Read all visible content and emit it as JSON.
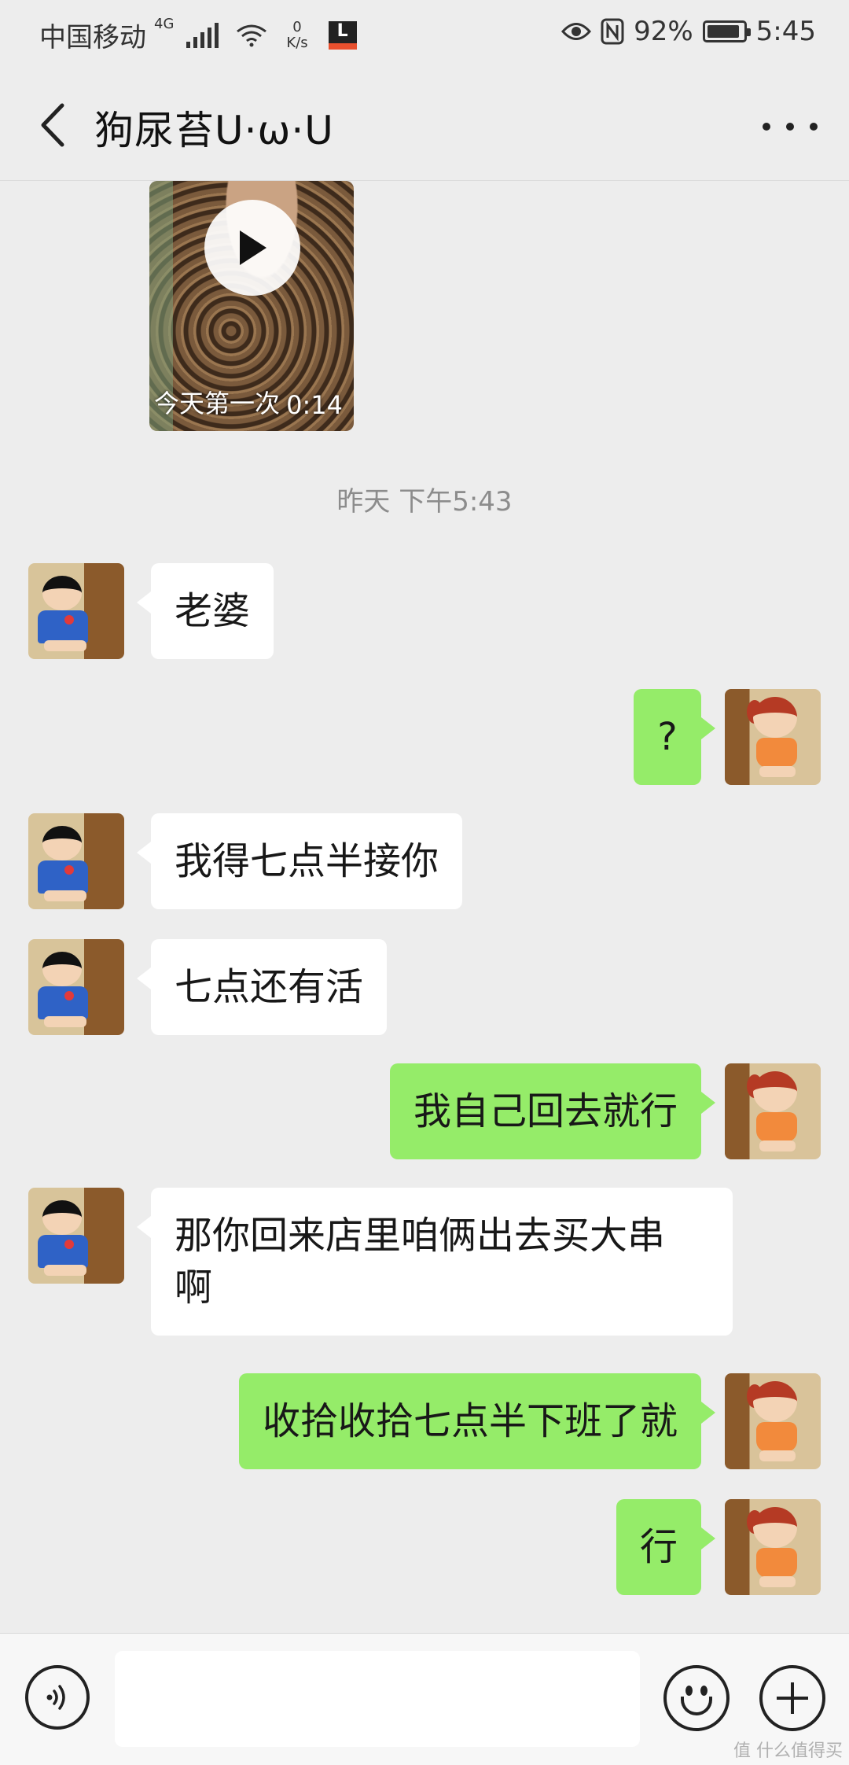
{
  "status_bar": {
    "carrier": "中国移动",
    "network": "4G",
    "net_speed_value": "0",
    "net_speed_unit": "K/s",
    "app_icon_letter": "L",
    "battery": "92%",
    "battery_level": 0.92,
    "time": "5:45"
  },
  "header": {
    "title": "狗尿苔U·ω·U"
  },
  "video_message": {
    "caption": "今天第一次",
    "duration": "0:14"
  },
  "timestamp": "昨天 下午5:43",
  "messages": [
    {
      "side": "in",
      "text": "老婆"
    },
    {
      "side": "out",
      "text": "?"
    },
    {
      "side": "in",
      "text": "我得七点半接你"
    },
    {
      "side": "in",
      "text": "七点还有活"
    },
    {
      "side": "out",
      "text": "我自己回去就行"
    },
    {
      "side": "in",
      "text": "那你回来店里咱俩出去买大串\n啊"
    },
    {
      "side": "out",
      "text": "收拾收拾七点半下班了就"
    },
    {
      "side": "out",
      "text": "行"
    }
  ],
  "input": {
    "value": "",
    "placeholder": ""
  },
  "icons": {
    "back": "chevron-left-icon",
    "more": "more-dots-icon",
    "play": "play-icon",
    "voice": "voice-icon",
    "emoji": "emoji-icon",
    "add": "plus-icon"
  },
  "colors": {
    "background": "#ededed",
    "bubble_out": "#95ec69",
    "bubble_in": "#ffffff"
  },
  "watermark": "值 什么值得买"
}
